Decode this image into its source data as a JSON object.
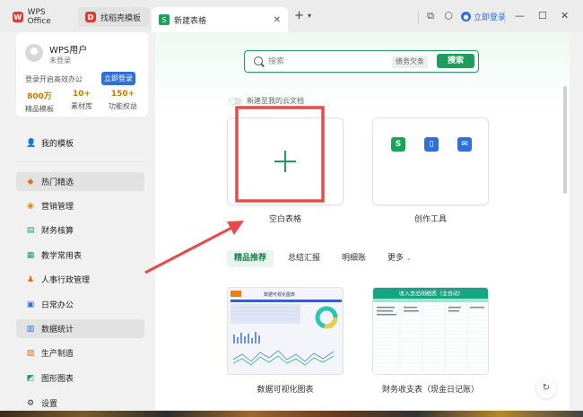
{
  "titlebar": {
    "tabs": [
      {
        "label": "WPS Office",
        "icon": "wps-logo-icon"
      },
      {
        "label": "找稻壳模板",
        "icon": "docer-logo-icon"
      },
      {
        "label": "新建表格",
        "icon": "spreadsheet-icon",
        "active": true
      }
    ],
    "login_label": "立即登录"
  },
  "sidebar": {
    "user": {
      "name": "WPS用户",
      "status": "未登录",
      "login_hint": "登录开启高效办公",
      "login_button": "立即登录",
      "stats": [
        {
          "num": "800万",
          "label": "精品模板"
        },
        {
          "num": "10+",
          "label": "素材库"
        },
        {
          "num": "150+",
          "label": "功能权益"
        }
      ]
    },
    "my_templates": "我的模板",
    "items": [
      {
        "label": "热门精选",
        "icon": "diamond-icon",
        "active": true
      },
      {
        "label": "营销管理",
        "icon": "coin-icon"
      },
      {
        "label": "财务核算",
        "icon": "finance-icon"
      },
      {
        "label": "教学常用表",
        "icon": "chart-icon"
      },
      {
        "label": "人事行政管理",
        "icon": "person-icon"
      },
      {
        "label": "日常办公",
        "icon": "calendar-icon"
      },
      {
        "label": "数据统计",
        "icon": "stats-icon",
        "active": true
      },
      {
        "label": "生产制造",
        "icon": "factory-icon"
      },
      {
        "label": "图形图表",
        "icon": "graph-icon"
      },
      {
        "label": "设置",
        "icon": "gear-icon"
      }
    ]
  },
  "main": {
    "search": {
      "placeholder": "搜索",
      "tag": "债务欠条",
      "button": "搜索"
    },
    "cloud_toggle": "新建至我的云文档",
    "cards": [
      {
        "label": "空白表格"
      },
      {
        "label": "创作工具"
      }
    ],
    "chips": [
      "精品推荐",
      "总结汇报",
      "明细账",
      "更多"
    ],
    "templates": [
      {
        "label": "数据可视化图表",
        "thumb_title": "数据可视化图表"
      },
      {
        "label": "财务收支表（现金日记账）",
        "thumb_title": "收入支出明细表（全自动）"
      }
    ]
  },
  "colors": {
    "brand_green": "#1e9e5e",
    "link_blue": "#2f6fd6",
    "annotation_red": "#e84a4a"
  }
}
